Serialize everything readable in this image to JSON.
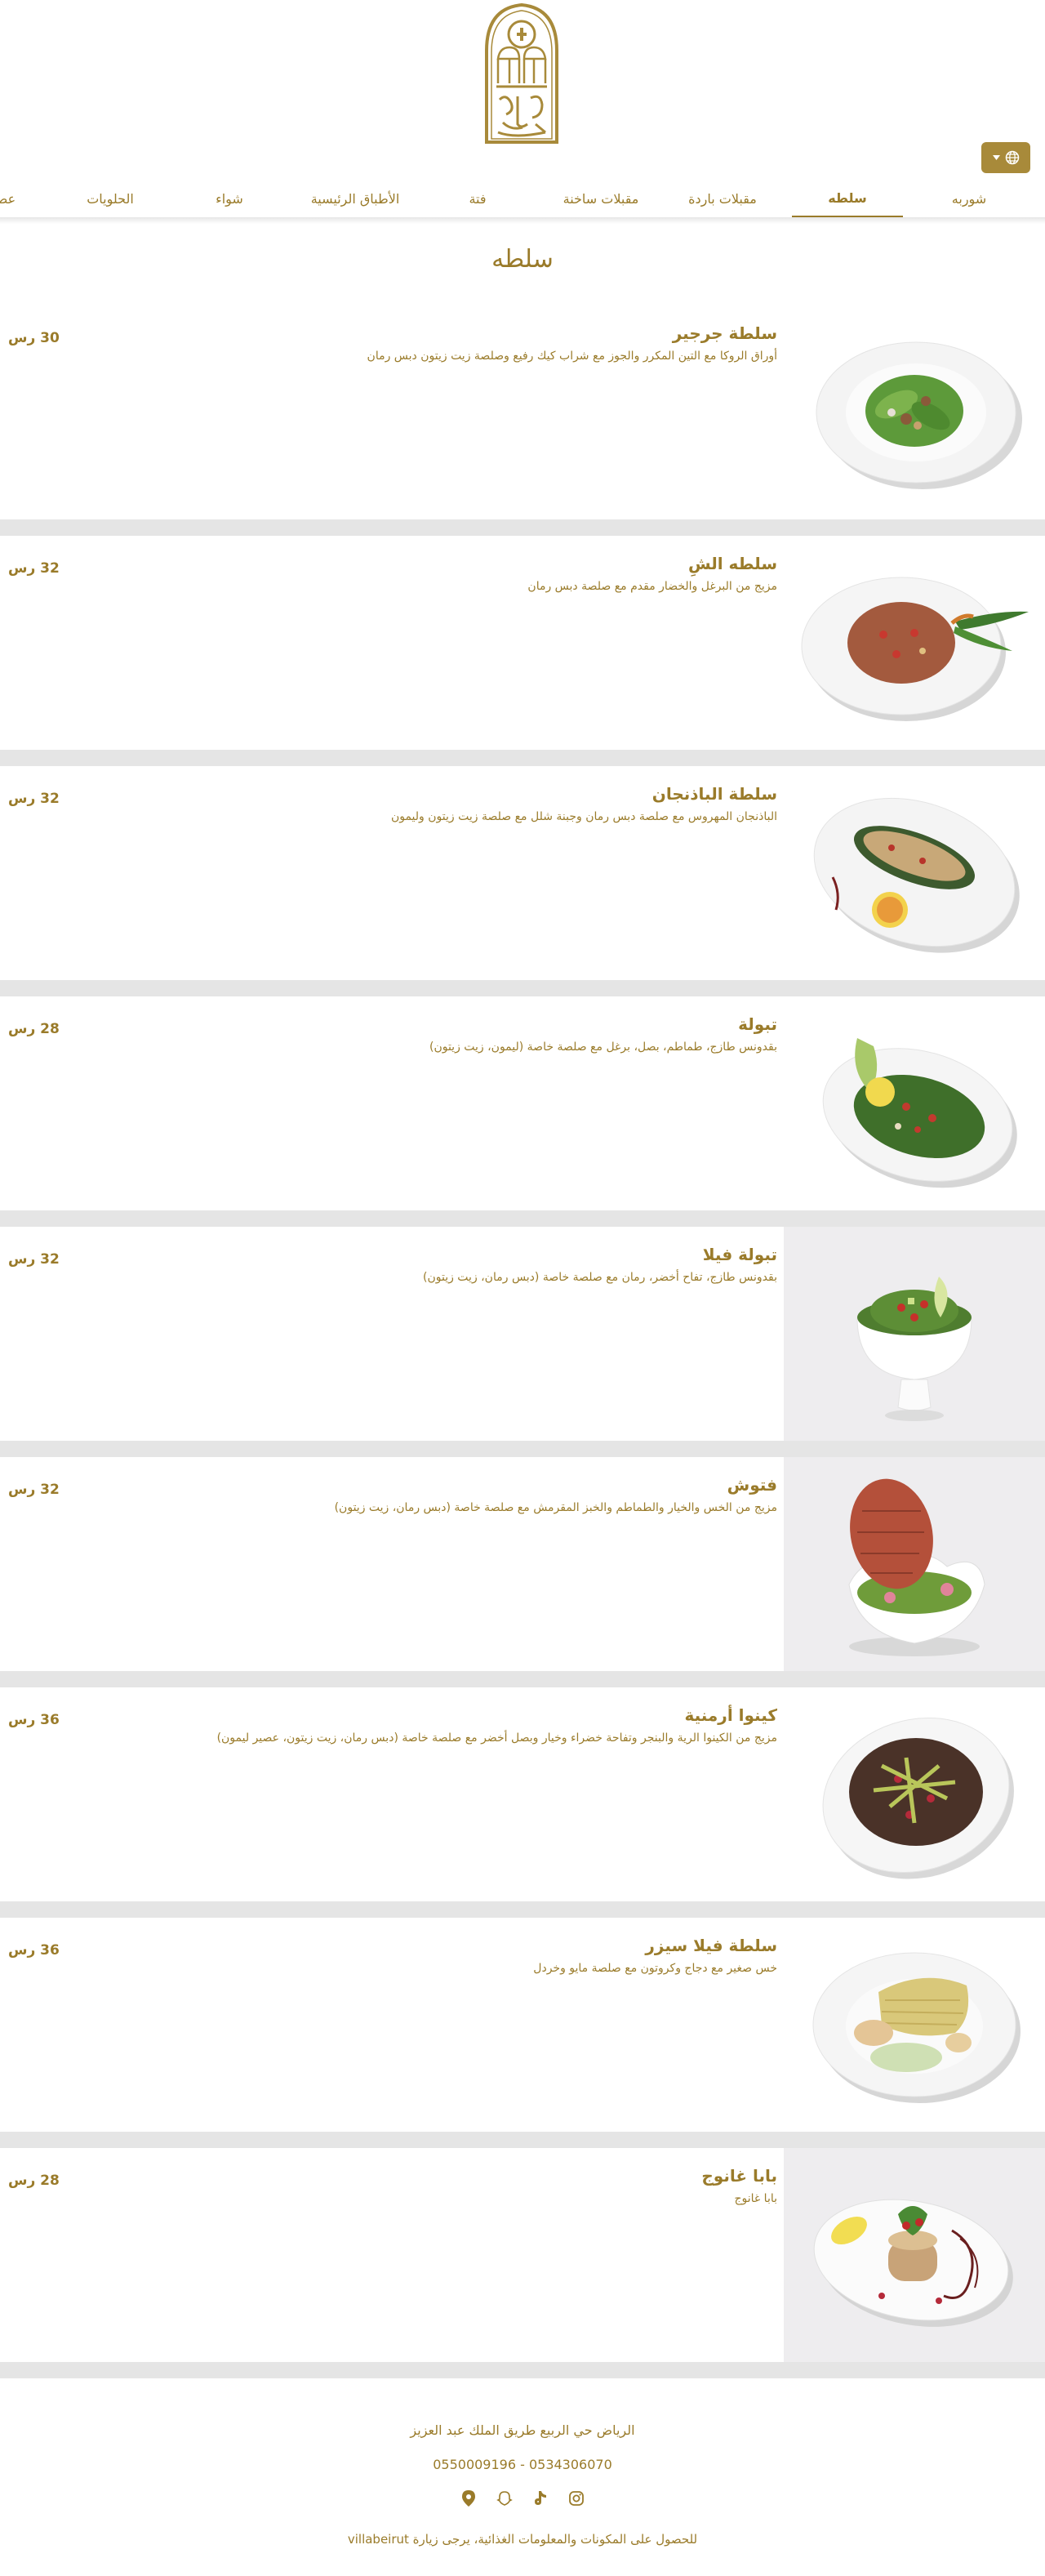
{
  "header": {
    "logo_name": "villa-beirut-logo",
    "lang_button_icon": "globe-icon"
  },
  "nav": {
    "items": [
      {
        "label": "شوربه"
      },
      {
        "label": "سلطه"
      },
      {
        "label": "مقبلات باردة"
      },
      {
        "label": "مقبلات ساخنة"
      },
      {
        "label": "فتة"
      },
      {
        "label": "الأطباق الرئيسية"
      },
      {
        "label": "شواء"
      },
      {
        "label": "الحلويات"
      },
      {
        "label": "عص"
      }
    ],
    "active": "سلطه"
  },
  "section": {
    "title": "سلطه"
  },
  "items": [
    {
      "name": "سلطة جرجير",
      "desc": "أوراق الروكا مع التين المكرر والجوز مع شراب كيك رفيع وصلصة زيت زيتون دبس رمان",
      "price": "30 رس",
      "image": "arugula-salad-plate"
    },
    {
      "name": "سلطه الشِ",
      "desc": "مزيج من البرغل والخضار مقدم مع صلصة دبس رمان",
      "price": "32 رس",
      "image": "bulgur-salad-plate"
    },
    {
      "name": "سلطة الباذنجان",
      "desc": "الباذنجان المهروس مع صلصة دبس رمان وجبنة شلل مع صلصة زيت زيتون وليمون",
      "price": "32 رس",
      "image": "eggplant-salad-plate"
    },
    {
      "name": "تبولة",
      "desc": "بقدونس طازج، طماطم، بصل، برغل مع صلصة خاصة (ليمون، زيت زيتون)",
      "price": "28 رس",
      "image": "tabbouleh-plate"
    },
    {
      "name": "تبولة فيلا",
      "desc": "بقدونس طازج، تفاح أخضر، رمان مع صلصة خاصة (دبس رمان، زيت زيتون)",
      "price": "32 رس",
      "image": "villa-tabbouleh-bowl"
    },
    {
      "name": "فتوش",
      "desc": "مزيج من الخس والخيار والطماطم والخبز المقرمش مع صلصة خاصة (دبس رمان، زيت زيتون)",
      "price": "32 رس",
      "image": "fattoush-bowl"
    },
    {
      "name": "كينوا أرمنية",
      "desc": "مزيج من الكينوا الرية والبنجر وتفاحة خضراء وخيار وبصل أخضر مع صلصة خاصة (دبس رمان، زيت زيتون، عصير ليمون)",
      "price": "36 رس",
      "image": "quinoa-salad-plate"
    },
    {
      "name": "سلطة فيلا سيزر",
      "desc": "خس صغير مع دجاج وكروتون مع صلصة مايو وخردل",
      "price": "36 رس",
      "image": "caesar-salad-plate"
    },
    {
      "name": "بابا غانوج",
      "desc": "بابا غانوج",
      "price": "28 رس",
      "image": "baba-ghanoush-plate"
    }
  ],
  "footer": {
    "address": "الرياض حي الربيع طريق الملك عبد العزيز",
    "phones": "0550009196 - 0534306070",
    "info": "للحصول على المكونات والمعلومات الغذائية، يرجى زيارة villabeirut",
    "social_icons": [
      "instagram-icon",
      "tiktok-icon",
      "snapchat-icon",
      "location-pin-icon"
    ]
  },
  "colors": {
    "brand": "#9a7b2a",
    "button": "#a88a3a",
    "separator": "#e5e5e5"
  }
}
